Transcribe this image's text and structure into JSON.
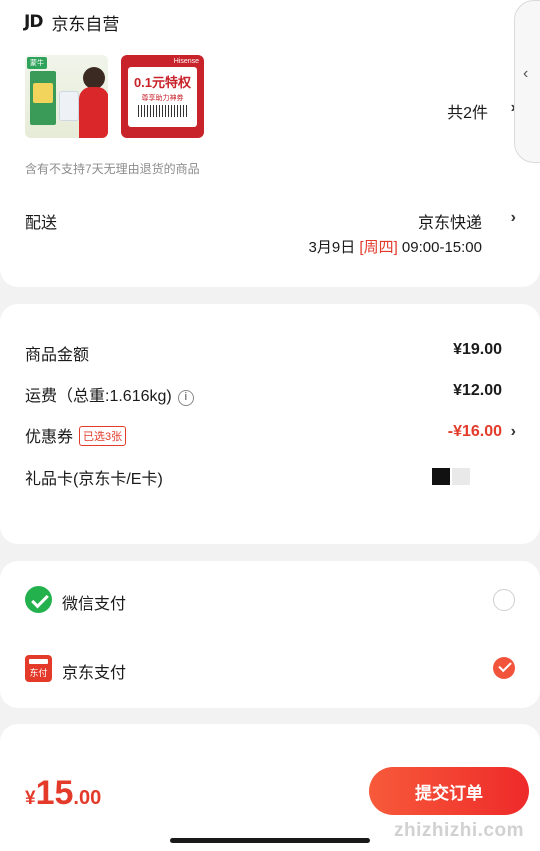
{
  "shop": {
    "logo": "JD",
    "name": "京东自营"
  },
  "products": {
    "items": [
      {
        "icon": "product-thumbnail",
        "tag_text": "蒙牛"
      },
      {
        "icon": "coupon-product-thumbnail",
        "brand_text": "Hisense",
        "headline": "0.1元特权",
        "subline": "尊享助力神券"
      }
    ],
    "count_label": "共2件"
  },
  "notice": "含有不支持7天无理由退货的商品",
  "delivery": {
    "label": "配送",
    "method": "京东快递",
    "date": "3月9日",
    "weekday": "[周四]",
    "time_range": "09:00-15:00"
  },
  "summary": {
    "goods_amount": {
      "label": "商品金额",
      "value": "¥19.00"
    },
    "shipping": {
      "label": "运费（总重:1.616kg)",
      "value": "¥12.00"
    },
    "coupon": {
      "label": "优惠券",
      "badge": "已选3张",
      "value": "-¥16.00"
    },
    "gift_card": {
      "label": "礼品卡(京东卡/E卡)"
    }
  },
  "payment": {
    "options": [
      {
        "label": "微信支付",
        "icon": "wechat-pay-icon",
        "selected": false
      },
      {
        "label": "京东支付",
        "icon": "jd-pay-icon",
        "icon_text": "东付",
        "selected": true
      }
    ]
  },
  "footer": {
    "total_currency": "¥",
    "total_int": "15",
    "total_dec": ".00",
    "submit_label": "提交订单",
    "watermark": "zhizhizhi.com"
  },
  "colors": {
    "accent": "#e33a2a",
    "wechat": "#23b14d",
    "background": "#f2f2f2"
  }
}
